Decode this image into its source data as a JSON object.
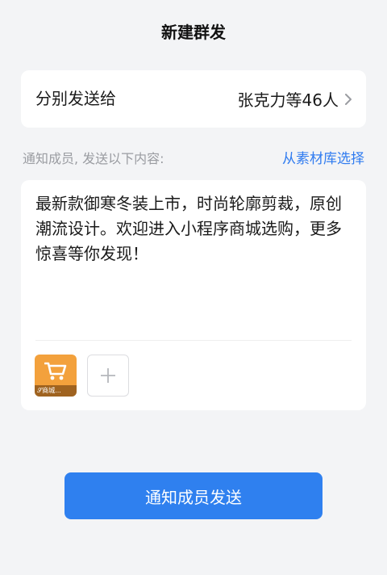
{
  "header": {
    "title": "新建群发"
  },
  "recipients": {
    "label": "分别发送给",
    "value": "张克力等46人"
  },
  "section": {
    "hint": "通知成员, 发送以下内容:",
    "material_link": "从素材库选择"
  },
  "message": {
    "text": "最新款御寒冬装上市，时尚轮廓剪裁，原创潮流设计。欢迎进入小程序商城选购，更多惊喜等你发现！"
  },
  "attachment": {
    "label": "商城...",
    "icon": "shopping-cart-icon",
    "color": "#f3a13c"
  },
  "actions": {
    "send_label": "通知成员发送",
    "accent": "#2f80ef"
  }
}
